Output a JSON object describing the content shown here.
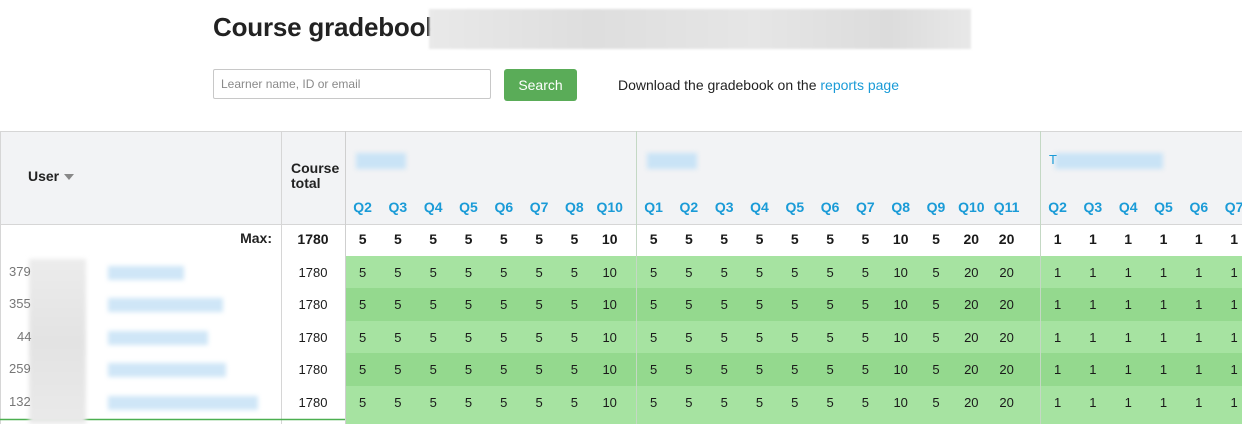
{
  "page": {
    "title": "Course gradebook",
    "search_placeholder": "Learner name, ID or email",
    "search_button": "Search",
    "download_text": "Download the gradebook on the ",
    "download_link": "reports page"
  },
  "table": {
    "user_header": "User",
    "total_header_line1": "Course",
    "total_header_line2": "total",
    "max_label": "Max:",
    "max_total": "1780",
    "sections": [
      {
        "first_char": "",
        "columns": [
          {
            "label": "Q2",
            "max": "5"
          },
          {
            "label": "Q3",
            "max": "5"
          },
          {
            "label": "Q4",
            "max": "5"
          },
          {
            "label": "Q5",
            "max": "5"
          },
          {
            "label": "Q6",
            "max": "5"
          },
          {
            "label": "Q7",
            "max": "5"
          },
          {
            "label": "Q8",
            "max": "5"
          },
          {
            "label": "Q10",
            "max": "10"
          }
        ]
      },
      {
        "first_char": "",
        "columns": [
          {
            "label": "Q1",
            "max": "5"
          },
          {
            "label": "Q2",
            "max": "5"
          },
          {
            "label": "Q3",
            "max": "5"
          },
          {
            "label": "Q4",
            "max": "5"
          },
          {
            "label": "Q5",
            "max": "5"
          },
          {
            "label": "Q6",
            "max": "5"
          },
          {
            "label": "Q7",
            "max": "5"
          },
          {
            "label": "Q8",
            "max": "10"
          },
          {
            "label": "Q9",
            "max": "5"
          },
          {
            "label": "Q10",
            "max": "20"
          },
          {
            "label": "Q11",
            "max": "20"
          }
        ]
      },
      {
        "first_char": "T",
        "columns": [
          {
            "label": "Q2",
            "max": "1"
          },
          {
            "label": "Q3",
            "max": "1"
          },
          {
            "label": "Q4",
            "max": "1"
          },
          {
            "label": "Q5",
            "max": "1"
          },
          {
            "label": "Q6",
            "max": "1"
          },
          {
            "label": "Q7",
            "max": "1"
          }
        ]
      }
    ],
    "rows": [
      {
        "id_prefix": "379",
        "total": "1780",
        "scores": [
          "5",
          "5",
          "5",
          "5",
          "5",
          "5",
          "5",
          "10",
          "5",
          "5",
          "5",
          "5",
          "5",
          "5",
          "5",
          "10",
          "5",
          "20",
          "20",
          "1",
          "1",
          "1",
          "1",
          "1",
          "1"
        ]
      },
      {
        "id_prefix": "355",
        "total": "1780",
        "scores": [
          "5",
          "5",
          "5",
          "5",
          "5",
          "5",
          "5",
          "10",
          "5",
          "5",
          "5",
          "5",
          "5",
          "5",
          "5",
          "10",
          "5",
          "20",
          "20",
          "1",
          "1",
          "1",
          "1",
          "1",
          "1"
        ]
      },
      {
        "id_prefix": "44",
        "total": "1780",
        "scores": [
          "5",
          "5",
          "5",
          "5",
          "5",
          "5",
          "5",
          "10",
          "5",
          "5",
          "5",
          "5",
          "5",
          "5",
          "5",
          "10",
          "5",
          "20",
          "20",
          "1",
          "1",
          "1",
          "1",
          "1",
          "1"
        ]
      },
      {
        "id_prefix": "259",
        "total": "1780",
        "scores": [
          "5",
          "5",
          "5",
          "5",
          "5",
          "5",
          "5",
          "10",
          "5",
          "5",
          "5",
          "5",
          "5",
          "5",
          "5",
          "10",
          "5",
          "20",
          "20",
          "1",
          "1",
          "1",
          "1",
          "1",
          "1"
        ]
      },
      {
        "id_prefix": "132",
        "total": "1780",
        "scores": [
          "5",
          "5",
          "5",
          "5",
          "5",
          "5",
          "5",
          "10",
          "5",
          "5",
          "5",
          "5",
          "5",
          "5",
          "5",
          "10",
          "5",
          "20",
          "20",
          "1",
          "1",
          "1",
          "1",
          "1",
          "1"
        ]
      }
    ]
  },
  "colors": {
    "link": "#1a9bd7",
    "search_button": "#5aac58",
    "cell_light": "#a6e3a1",
    "cell_dark": "#94d98e",
    "header_bg": "#f2f3f5"
  }
}
